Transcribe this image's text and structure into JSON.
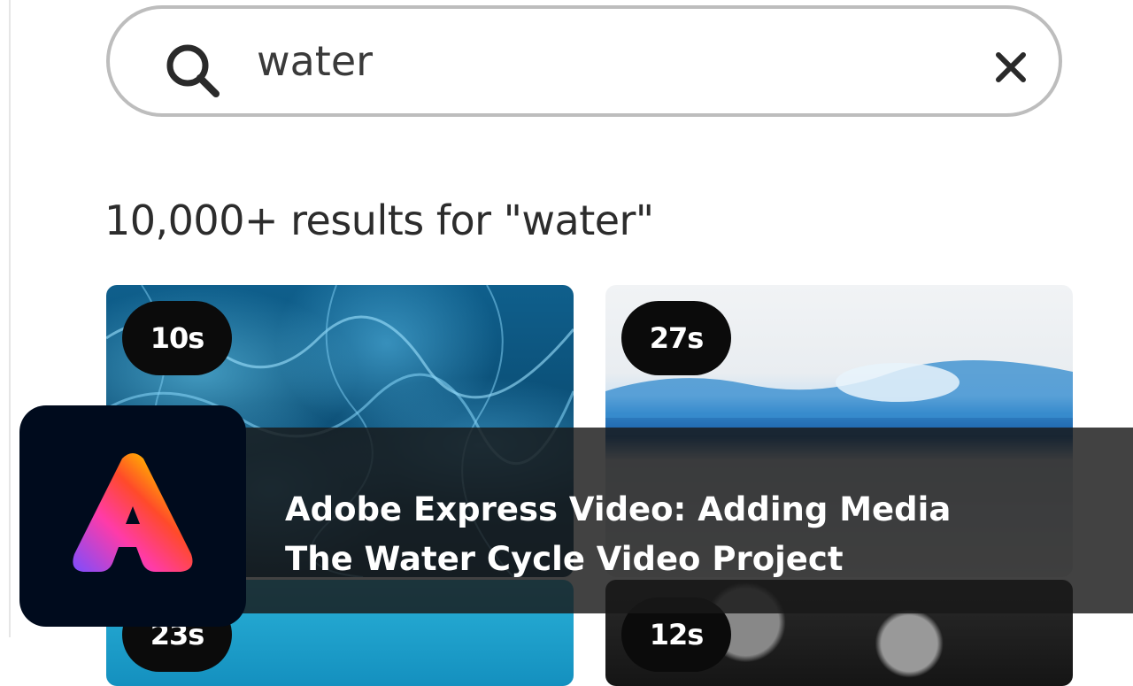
{
  "search": {
    "query": "water",
    "icon": "search-icon",
    "clear_icon": "close-icon"
  },
  "results": {
    "count_text": "10,000+ results for \"water\""
  },
  "media_tiles": [
    {
      "duration": "10s"
    },
    {
      "duration": "27s"
    },
    {
      "duration": "23s"
    },
    {
      "duration": "12s"
    }
  ],
  "overlay": {
    "line1": "Adobe Express Video: Adding Media",
    "line2": "The Water Cycle Video Project",
    "logo": "adobe-express-logo"
  },
  "colors": {
    "overlay_bg": "#191919",
    "logo_bg": "#000b1d",
    "badge_bg": "#0b0b0b"
  }
}
